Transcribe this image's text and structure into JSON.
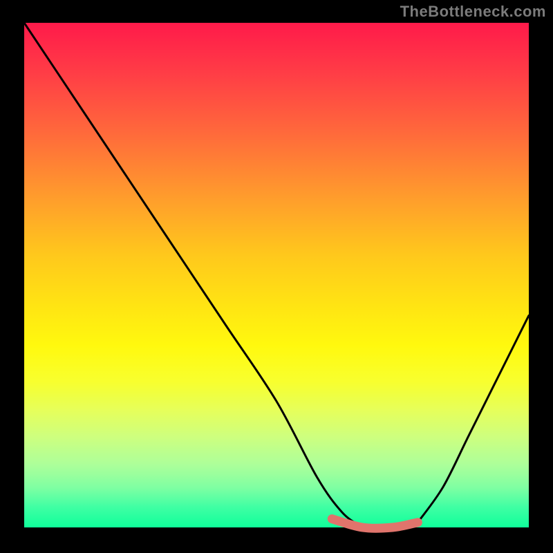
{
  "watermark": "TheBottleneck.com",
  "chart_data": {
    "type": "line",
    "title": "",
    "xlabel": "",
    "ylabel": "",
    "xlim": [
      0,
      100
    ],
    "ylim": [
      0,
      100
    ],
    "grid": false,
    "legend": false,
    "series": [
      {
        "name": "left-curve",
        "color": "#000000",
        "x": [
          0,
          10,
          20,
          30,
          40,
          50,
          58,
          63,
          67
        ],
        "y": [
          100,
          85,
          70,
          55,
          40,
          25,
          10,
          3,
          0
        ]
      },
      {
        "name": "valley-flat",
        "color": "#e0746c",
        "x": [
          61,
          67,
          73,
          78
        ],
        "y": [
          1.7,
          0,
          0,
          1.0
        ]
      },
      {
        "name": "right-curve",
        "color": "#000000",
        "x": [
          78,
          83,
          88,
          93,
          98,
          100
        ],
        "y": [
          1,
          8,
          18,
          28,
          38,
          42
        ]
      }
    ],
    "gradient_stops": [
      {
        "pos": 0.0,
        "color": "#ff1a4a"
      },
      {
        "pos": 0.1,
        "color": "#ff3d46"
      },
      {
        "pos": 0.22,
        "color": "#ff6a3b"
      },
      {
        "pos": 0.34,
        "color": "#ff9a2d"
      },
      {
        "pos": 0.46,
        "color": "#ffc81c"
      },
      {
        "pos": 0.56,
        "color": "#ffe413"
      },
      {
        "pos": 0.64,
        "color": "#fff90e"
      },
      {
        "pos": 0.71,
        "color": "#f8ff2e"
      },
      {
        "pos": 0.77,
        "color": "#e4ff58"
      },
      {
        "pos": 0.82,
        "color": "#c8ff78"
      },
      {
        "pos": 0.87,
        "color": "#a0ff8e"
      },
      {
        "pos": 0.92,
        "color": "#6cff9a"
      },
      {
        "pos": 0.96,
        "color": "#2cff9e"
      },
      {
        "pos": 1.0,
        "color": "#04ff98"
      }
    ]
  }
}
